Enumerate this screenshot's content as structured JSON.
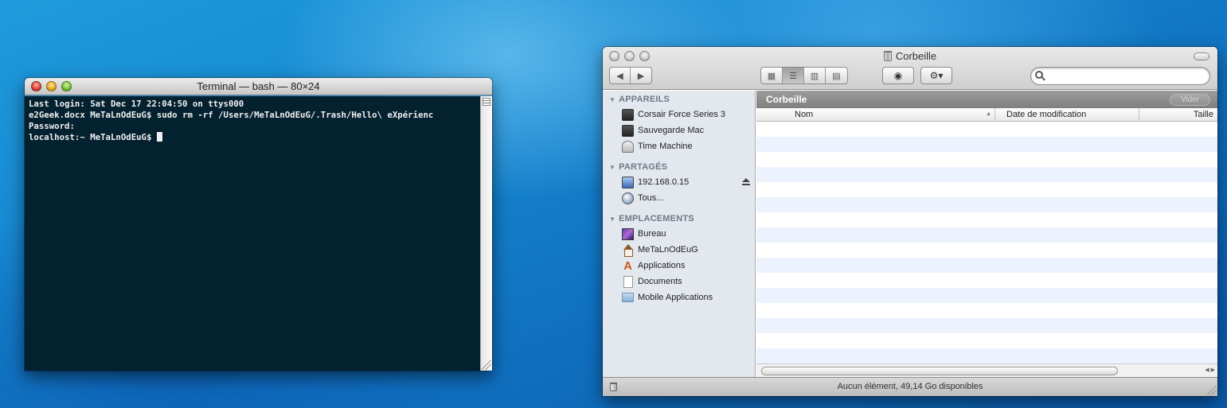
{
  "terminal": {
    "title": "Terminal — bash — 80×24",
    "lines": [
      "Last login: Sat Dec 17 22:04:50 on ttys000",
      "e2Geek.docx MeTaLnOdEuG$ sudo rm -rf /Users/MeTaLnOdEuG/.Trash/Hello\\ eXpérienc",
      "Password:",
      "localhost:~ MeTaLnOdEuG$ "
    ]
  },
  "finder": {
    "title": "Corbeille",
    "search": {
      "value": "",
      "placeholder": ""
    },
    "sidebar": {
      "sections": [
        {
          "label": "APPAREILS",
          "items": [
            "Corsair Force Series 3",
            "Sauvegarde Mac",
            "Time Machine"
          ]
        },
        {
          "label": "PARTAGÉS",
          "items": [
            "192.168.0.15",
            "Tous..."
          ]
        },
        {
          "label": "EMPLACEMENTS",
          "items": [
            "Bureau",
            "MeTaLnOdEuG",
            "Applications",
            "Documents",
            "Mobile Applications"
          ]
        }
      ]
    },
    "path_title": "Corbeille",
    "empty_button": "Vider",
    "columns": [
      "Nom",
      "Date de modification",
      "Taille"
    ],
    "status": "Aucun élément, 49,14 Go disponibles"
  },
  "colors": {
    "terminal_bg": "#042130",
    "terminal_text": "#f0f0f0",
    "row_stripe": "#edf3fe",
    "sidebar_bg": "#e3e8ee"
  },
  "icons": {
    "devices": [
      "hard-disk-icon",
      "hard-disk-icon",
      "time-machine-icon"
    ],
    "shared": [
      "computer-icon",
      "network-globe-icon"
    ],
    "places": [
      "desktop-icon",
      "home-icon",
      "applications-icon",
      "document-icon",
      "folder-icon"
    ]
  }
}
